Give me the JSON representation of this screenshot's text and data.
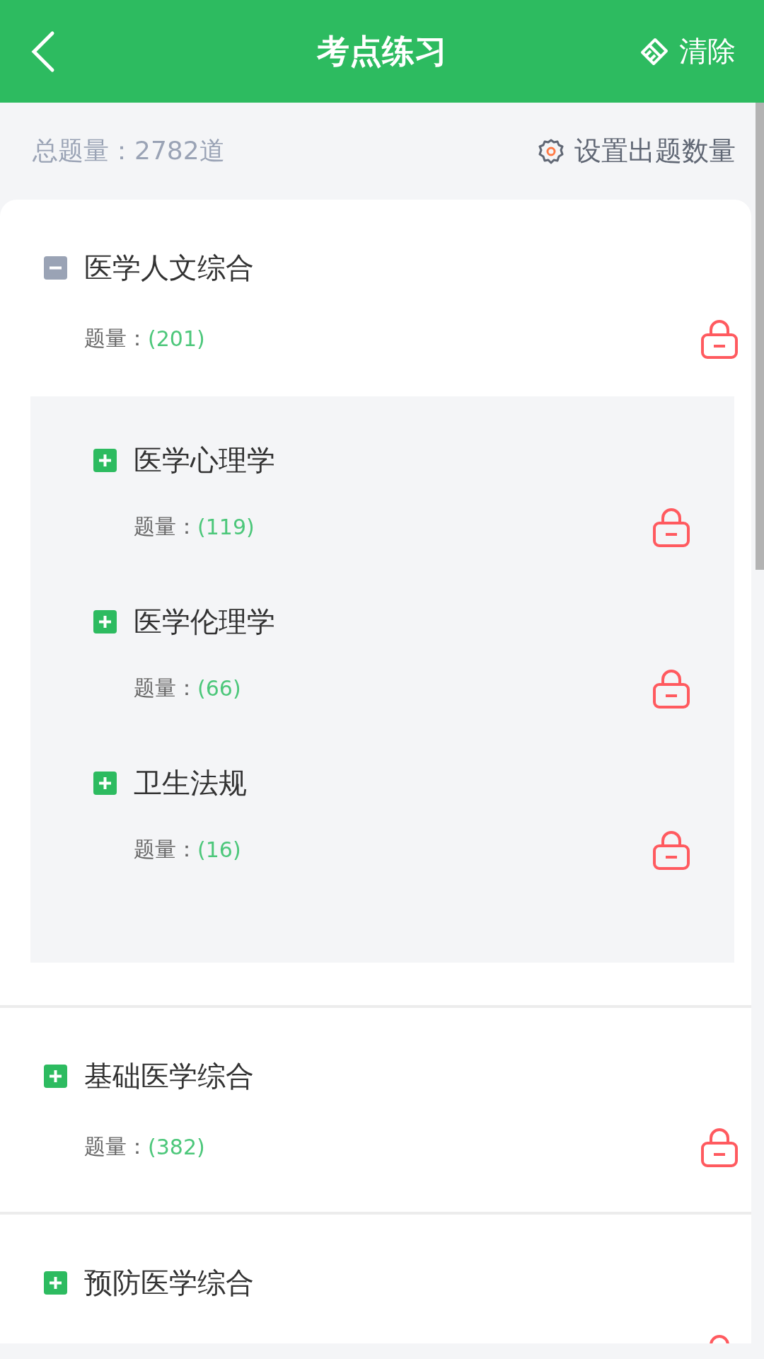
{
  "header": {
    "title": "考点练习",
    "clear_button": "清除"
  },
  "summary": {
    "total": "总题量：2782道",
    "settings_button": "设置出题数量"
  },
  "categories": [
    {
      "title": "医学人文综合",
      "expanded": true,
      "count_label": "题量：",
      "count": "(201)",
      "children": [
        {
          "title": "医学心理学",
          "expanded": false,
          "count_label": "题量：",
          "count": "(119)"
        },
        {
          "title": "医学伦理学",
          "expanded": false,
          "count_label": "题量：",
          "count": "(66)"
        },
        {
          "title": "卫生法规",
          "expanded": false,
          "count_label": "题量：",
          "count": "(16)"
        }
      ]
    },
    {
      "title": "基础医学综合",
      "expanded": false,
      "count_label": "题量：",
      "count": "(382)"
    },
    {
      "title": "预防医学综合",
      "expanded": false
    }
  ]
}
